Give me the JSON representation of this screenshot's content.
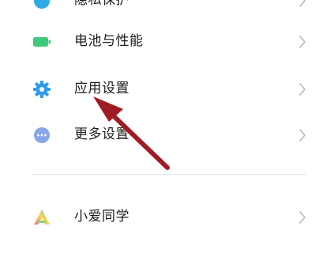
{
  "settings": {
    "items": [
      {
        "label": "隐私保护",
        "icon": "privacy-shield-icon",
        "icon_color": "#2fa9e8"
      },
      {
        "label": "电池与性能",
        "icon": "battery-icon",
        "icon_color": "#3ecb79"
      },
      {
        "label": "应用设置",
        "icon": "gear-icon",
        "icon_color": "#2f9bec"
      },
      {
        "label": "更多设置",
        "icon": "more-dots-icon",
        "icon_color": "#8aa6e8"
      },
      {
        "label": "小爱同学",
        "icon": "xiaoai-icon",
        "icon_color": "#55c7f2"
      }
    ]
  },
  "colors": {
    "chevron": "#b8b8b8",
    "divider": "#e6e6e6",
    "annotation_arrow": "#a01c24"
  },
  "annotation": {
    "icon": "red-arrow-pointer",
    "target": "应用设置"
  }
}
